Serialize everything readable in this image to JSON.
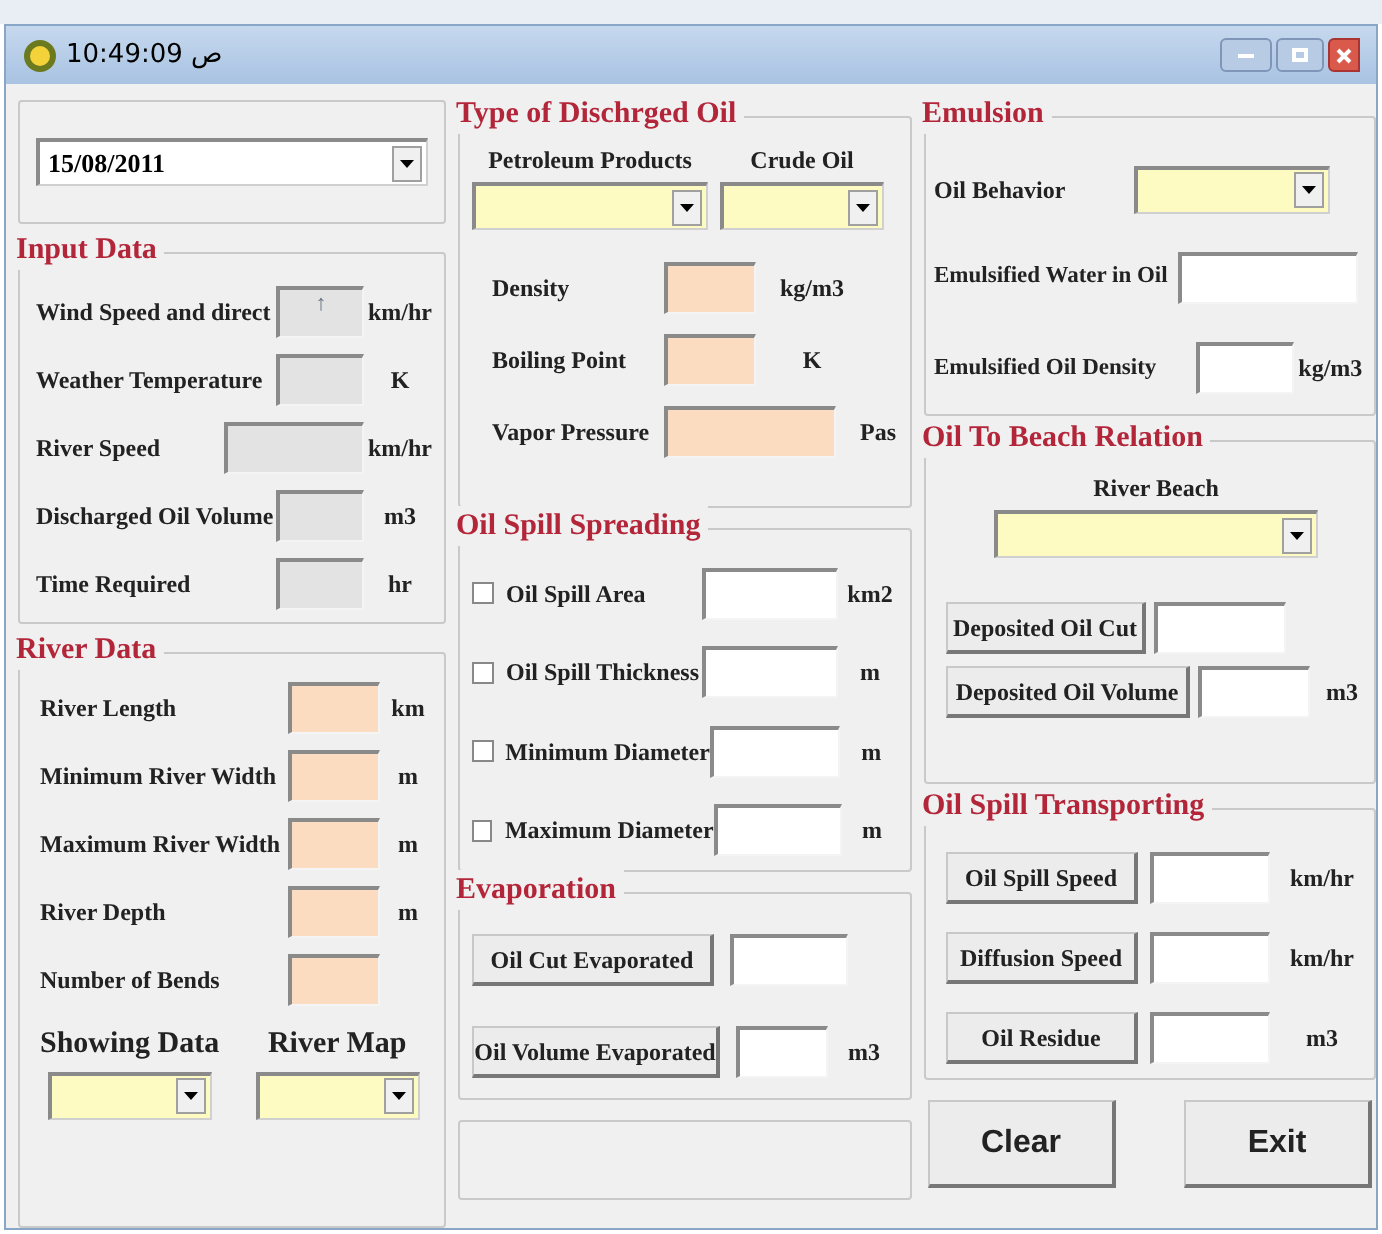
{
  "window": {
    "title": "10:49:09 ص"
  },
  "date_combo": {
    "value": "15/08/2011"
  },
  "input_data": {
    "title": "Input Data",
    "rows": [
      {
        "label": "Wind Speed and direct",
        "kind": "readonly",
        "value": "↑",
        "unit": "km/hr"
      },
      {
        "label": "Weather Temperature",
        "kind": "readonly",
        "unit": "K"
      },
      {
        "label": "River Speed",
        "kind": "readonly",
        "unit": "km/hr"
      },
      {
        "label": "Discharged Oil Volume",
        "kind": "readonly",
        "unit": "m3"
      },
      {
        "label": "Time Required",
        "kind": "readonly",
        "unit": "hr"
      }
    ]
  },
  "river_data": {
    "title": "River Data",
    "rows": [
      {
        "label": "River Length",
        "kind": "input",
        "unit": "km"
      },
      {
        "label": "Minimum River Width",
        "kind": "input",
        "unit": "m"
      },
      {
        "label": "Maximum River Width",
        "kind": "input",
        "unit": "m"
      },
      {
        "label": "River Depth",
        "kind": "input",
        "unit": "m"
      },
      {
        "label": "Number of Bends",
        "kind": "input"
      }
    ],
    "dropdowns": [
      {
        "label": "Showing Data"
      },
      {
        "label": "River Map"
      }
    ]
  },
  "oil_type": {
    "title": "Type of Dischrged Oil",
    "dropdowns": [
      {
        "label": "Petroleum Products"
      },
      {
        "label": "Crude Oil"
      }
    ],
    "rows": [
      {
        "label": "Density",
        "kind": "input",
        "unit": "kg/m3"
      },
      {
        "label": "Boiling Point",
        "kind": "input",
        "unit": "K"
      },
      {
        "label": "Vapor Pressure",
        "kind": "input",
        "unit": "Pas"
      }
    ]
  },
  "spreading": {
    "title": "Oil Spill Spreading",
    "rows": [
      {
        "label": "Oil Spill Area",
        "checked": false,
        "unit": "km2"
      },
      {
        "label": "Oil Spill Thickness",
        "checked": false,
        "unit": "m"
      },
      {
        "label": "Minimum Diameter",
        "checked": false,
        "unit": "m"
      },
      {
        "label": "Maximum Diameter",
        "checked": false,
        "unit": "m"
      }
    ]
  },
  "evaporation": {
    "title": "Evaporation",
    "rows": [
      {
        "button": "Oil Cut Evaporated"
      },
      {
        "button": "Oil Volume Evaporated",
        "unit": "m3"
      }
    ]
  },
  "emulsion": {
    "title": "Emulsion",
    "dropdown": {
      "label": "Oil Behavior"
    },
    "rows": [
      {
        "label": "Emulsified Water in Oil"
      },
      {
        "label": "Emulsified Oil Density",
        "unit": "kg/m3"
      }
    ]
  },
  "beach": {
    "title": "Oil To Beach Relation",
    "dropdown": {
      "label": "River Beach"
    },
    "rows": [
      {
        "button": "Deposited Oil Cut"
      },
      {
        "button": "Deposited Oil Volume",
        "unit": "m3"
      }
    ]
  },
  "transporting": {
    "title": "Oil Spill Transporting",
    "rows": [
      {
        "button": "Oil Spill Speed",
        "unit": "km/hr"
      },
      {
        "button": "Diffusion Speed",
        "unit": "km/hr"
      },
      {
        "button": "Oil Residue",
        "unit": "m3"
      }
    ]
  },
  "buttons": [
    {
      "label": "Clear"
    },
    {
      "label": "Exit"
    }
  ]
}
